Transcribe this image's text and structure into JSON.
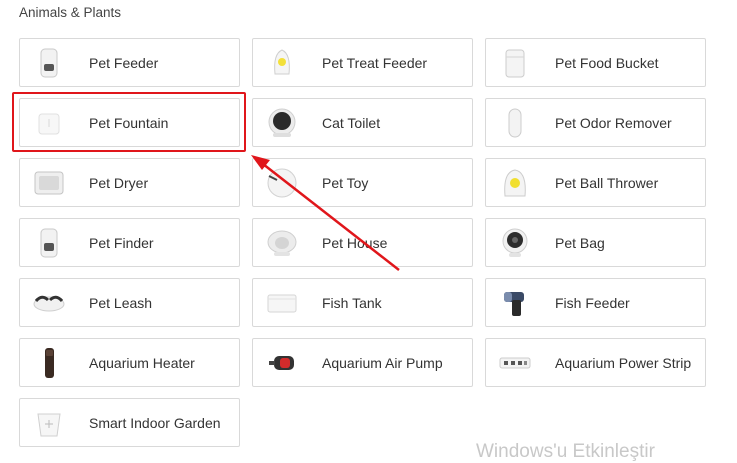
{
  "section": {
    "title": "Animals & Plants"
  },
  "devices": [
    {
      "label": "Pet Feeder",
      "icon": "pet-feeder-icon"
    },
    {
      "label": "Pet Treat Feeder",
      "icon": "pet-treat-feeder-icon"
    },
    {
      "label": "Pet Food Bucket",
      "icon": "pet-food-bucket-icon"
    },
    {
      "label": "Pet Fountain",
      "icon": "pet-fountain-icon"
    },
    {
      "label": "Cat Toilet",
      "icon": "cat-toilet-icon"
    },
    {
      "label": "Pet Odor Remover",
      "icon": "pet-odor-remover-icon"
    },
    {
      "label": "Pet Dryer",
      "icon": "pet-dryer-icon"
    },
    {
      "label": "Pet Toy",
      "icon": "pet-toy-icon"
    },
    {
      "label": "Pet Ball Thrower",
      "icon": "pet-ball-thrower-icon"
    },
    {
      "label": "Pet Finder",
      "icon": "pet-finder-icon"
    },
    {
      "label": "Pet House",
      "icon": "pet-house-icon"
    },
    {
      "label": "Pet Bag",
      "icon": "pet-bag-icon"
    },
    {
      "label": "Pet Leash",
      "icon": "pet-leash-icon"
    },
    {
      "label": "Fish Tank",
      "icon": "fish-tank-icon"
    },
    {
      "label": "Fish Feeder",
      "icon": "fish-feeder-icon"
    },
    {
      "label": "Aquarium Heater",
      "icon": "aquarium-heater-icon"
    },
    {
      "label": "Aquarium Air Pump",
      "icon": "aquarium-air-pump-icon"
    },
    {
      "label": "Aquarium Power Strip",
      "icon": "aquarium-power-strip-icon"
    },
    {
      "label": "Smart Indoor Garden",
      "icon": "smart-indoor-garden-icon"
    }
  ],
  "annotation": {
    "highlighted_item": "Pet Fountain",
    "color": "#e0161b"
  },
  "watermark": {
    "text": "Windows'u Etkinleştir"
  }
}
